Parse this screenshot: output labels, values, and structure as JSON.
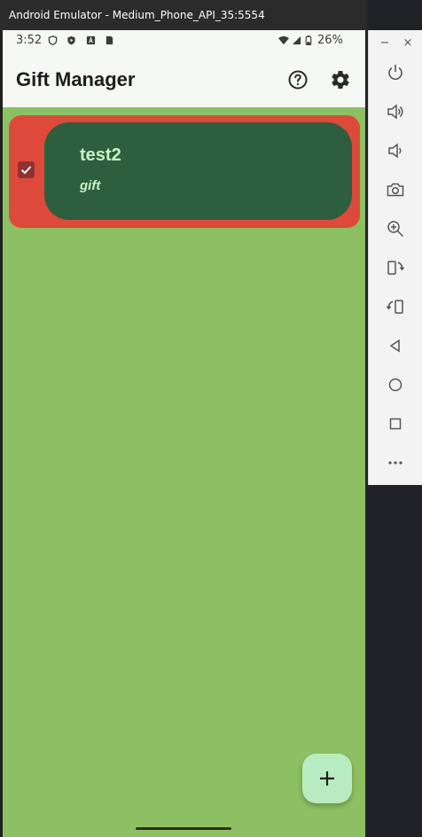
{
  "window": {
    "title": "Android Emulator - Medium_Phone_API_35:5554",
    "minimize_label": "−",
    "close_label": "×"
  },
  "statusbar": {
    "time": "3:52",
    "battery": "26%",
    "icons": [
      "shield-icon",
      "play-protect-icon",
      "accessibility-a-icon",
      "sim-card-icon",
      "wifi-icon",
      "signal-icon",
      "battery-icon"
    ]
  },
  "appbar": {
    "title": "Gift Manager",
    "help_icon": "help-circle-icon",
    "settings_icon": "gear-icon"
  },
  "gift_list": [
    {
      "title": "test2",
      "subtitle": "gift",
      "checked": true
    }
  ],
  "fab": {
    "icon": "plus-icon",
    "label": "+"
  },
  "side_toolbar": {
    "tools": [
      "power-icon",
      "volume-up-icon",
      "volume-down-icon",
      "camera-icon",
      "zoom-icon",
      "rotate-left-icon",
      "rotate-right-icon",
      "back-icon",
      "home-icon",
      "overview-icon",
      "more-icon"
    ]
  },
  "colors": {
    "background": "#8dc063",
    "item_background": "#de4a3a",
    "card": "#2d5e3d",
    "card_text": "#c9f5c5",
    "fab": "#b8ecc0",
    "checkbox": "#8e3232"
  }
}
